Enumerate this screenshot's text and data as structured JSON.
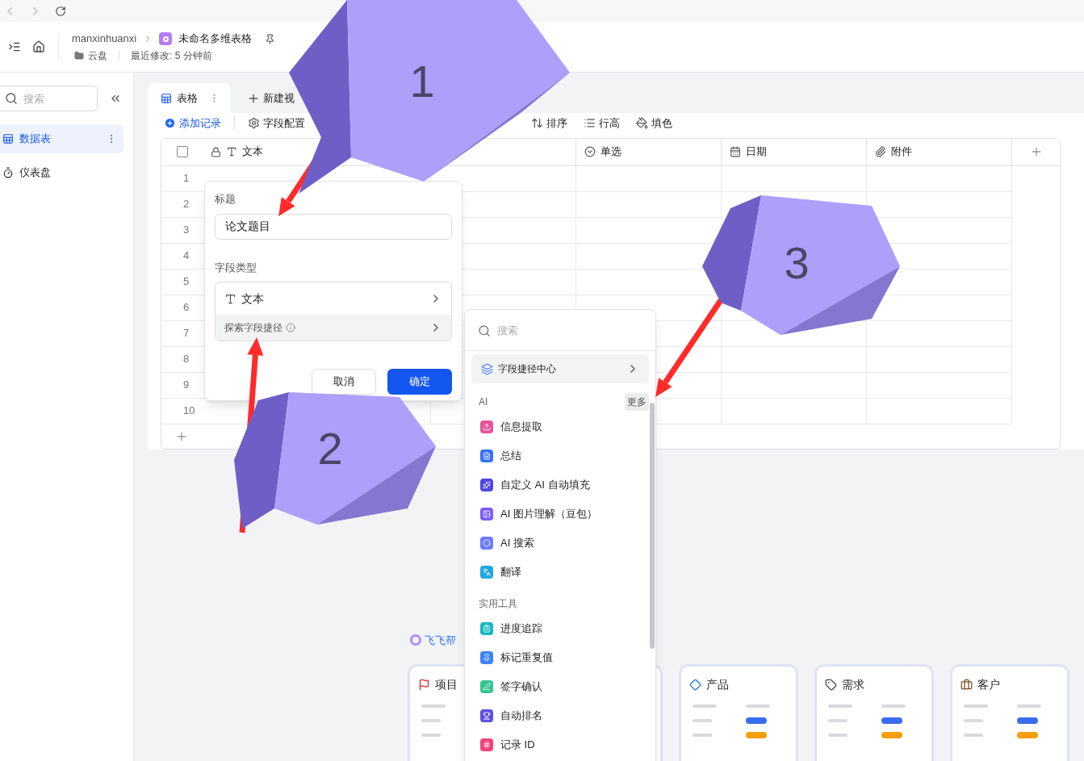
{
  "header": {
    "breadcrumb": "manxinhuanxi",
    "doc_title": "未命名多维表格",
    "location": "云盘",
    "modified": "最近修改: 5 分钟前"
  },
  "sidebar": {
    "search_placeholder": "搜索",
    "items": [
      {
        "label": "数据表",
        "selected": true,
        "kind": "table"
      },
      {
        "label": "仪表盘",
        "selected": false,
        "kind": "dashboard"
      }
    ]
  },
  "views": [
    {
      "label": "表格",
      "selected": true
    }
  ],
  "new_view": "新建视",
  "toolbar": [
    {
      "label": "添加记录",
      "kind": "add"
    },
    {
      "label": "字段配置",
      "kind": "fields"
    },
    {
      "label": "排序",
      "kind": "sort"
    },
    {
      "label": "行高",
      "kind": "height"
    },
    {
      "label": "填色",
      "kind": "fill"
    }
  ],
  "table": {
    "columns": [
      {
        "label": "文本",
        "kind": "text"
      },
      {
        "kind": "covered"
      },
      {
        "label": "单选",
        "kind": "select"
      },
      {
        "label": "日期",
        "kind": "date"
      },
      {
        "label": "附件",
        "kind": "attachment"
      }
    ],
    "select_all_checked": false,
    "rows": [
      "1",
      "2",
      "3",
      "4",
      "5",
      "6",
      "7",
      "8",
      "9",
      "10"
    ]
  },
  "field_editor": {
    "title_label": "标题",
    "title_value": "论文题目",
    "type_label": "字段类型",
    "type": "文本",
    "shortcut": "探索字段捷径",
    "cancel": "取消",
    "confirm": "确定"
  },
  "type_menu": {
    "search_placeholder": "搜索",
    "hub": "字段捷径中心",
    "sections": [
      {
        "title": "AI",
        "more": "更多",
        "items": [
          {
            "label": "信息提取",
            "kind": "extract",
            "color": "#e4569a"
          },
          {
            "label": "总结",
            "kind": "summary",
            "color": "#3370ff"
          },
          {
            "label": "自定义 AI 自动填充",
            "kind": "sparkle",
            "color": "#4f46e5"
          },
          {
            "label": "AI 图片理解（豆包）",
            "kind": "image",
            "color": "#7c5cff"
          },
          {
            "label": "AI 搜索",
            "kind": "search",
            "color": "#6b7cff"
          },
          {
            "label": "翻译",
            "kind": "translate",
            "color": "#1fa8e0"
          }
        ]
      },
      {
        "title": "实用工具",
        "items": [
          {
            "label": "进度追踪",
            "kind": "clipboard",
            "color": "#14b8c4"
          },
          {
            "label": "标记重复值",
            "kind": "pin",
            "color": "#3b82f6"
          },
          {
            "label": "签字确认",
            "kind": "sign",
            "color": "#34c38f"
          },
          {
            "label": "自动排名",
            "kind": "rank",
            "color": "#5b4fe0"
          },
          {
            "label": "记录 ID",
            "kind": "id",
            "color": "#f0437a"
          }
        ]
      }
    ]
  },
  "assistant": "飞飞帮",
  "templates": [
    {
      "title": "项目",
      "kind": "project"
    },
    {
      "kind": "covered"
    },
    {
      "title": "产品",
      "kind": "product"
    },
    {
      "title": "需求",
      "kind": "requirement"
    },
    {
      "title": "客户",
      "kind": "customer"
    }
  ],
  "annotations": [
    {
      "number": "1"
    },
    {
      "number": "2"
    },
    {
      "number": "3"
    }
  ]
}
